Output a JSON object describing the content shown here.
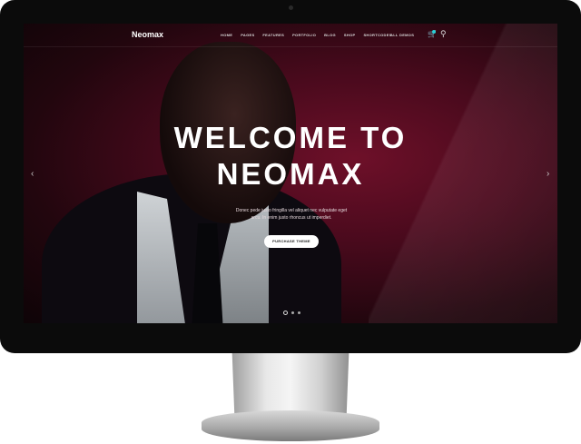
{
  "header": {
    "logo": "Neomax",
    "menu": [
      "HOME",
      "PAGES",
      "FEATURES",
      "PORTFOLIO",
      "BLOG",
      "SHOP",
      "SHORTCODES"
    ],
    "all_demos": "ALL DEMOS"
  },
  "hero": {
    "title_line1": "WELCOME TO",
    "title_line2": "NEOMAX",
    "description": "Donec pede justo fringilla vel aliquet nec vulputate eget arcu. In enim justo rhoncus ut imperdiet.",
    "button": "PURCHASE THEME",
    "prev": "‹",
    "next": "›",
    "slide_count": 3,
    "active_slide": 1
  },
  "icons": {
    "cart": "cart-icon",
    "search": "search-icon"
  },
  "colors": {
    "accent": "#2ad0d8",
    "hero_bg": "#4a0a1d"
  }
}
